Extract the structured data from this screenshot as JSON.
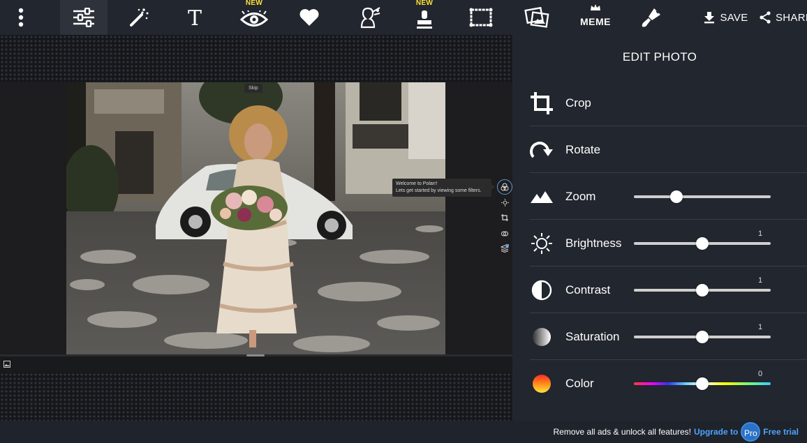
{
  "toolbar": {
    "new_badge": "NEW",
    "new_badge_2": "NEW",
    "meme_label": "MEME",
    "save_label": "SAVE",
    "share_label": "SHARE",
    "icons": [
      "menu-dots-icon",
      "adjust-sliders-icon",
      "magic-wand-icon",
      "text-icon",
      "eye-icon",
      "heart-icon",
      "face-edit-icon",
      "stamp-icon",
      "frame-icon",
      "photo-frames-icon",
      "meme-icon",
      "brush-icon",
      "download-icon",
      "share-icon"
    ]
  },
  "editor": {
    "skip_label": "Skip",
    "tooltip_line1": "Welcome to Polarr!",
    "tooltip_line2": "Lets get started by viewing some filters."
  },
  "panel": {
    "title": "EDIT PHOTO",
    "crop_label": "Crop",
    "rotate_label": "Rotate",
    "zoom_label": "Zoom",
    "zoom_value": 0.31,
    "brightness_label": "Brightness",
    "brightness_value": "1",
    "brightness_pos": 0.5,
    "contrast_label": "Contrast",
    "contrast_value": "1",
    "contrast_pos": 0.5,
    "saturation_label": "Saturation",
    "saturation_value": "1",
    "saturation_pos": 0.5,
    "color_label": "Color",
    "color_value": "0",
    "color_pos": 0.5
  },
  "footer": {
    "text": "Remove all ads & unlock all features!",
    "upgrade_link": "Upgrade to",
    "pro_badge": "Pro",
    "trial_link": "Free trial"
  },
  "colors": {
    "accent": "#4ea3ff",
    "badge": "#ffe23a",
    "panel_bg": "#22262e"
  }
}
